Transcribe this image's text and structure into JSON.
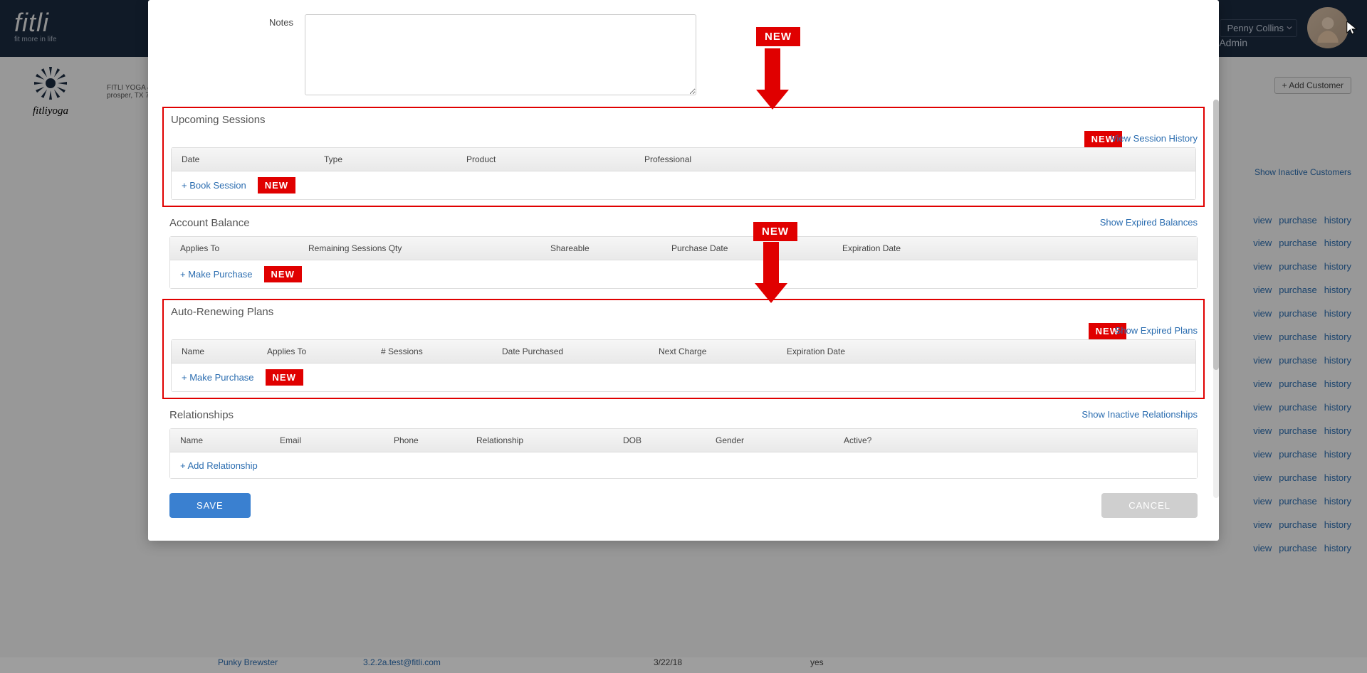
{
  "header": {
    "brand": "fitli",
    "tagline": "fit more in life",
    "user_name": "Penny Collins",
    "admin_link": "Admin"
  },
  "sidebar": {
    "biz_name": "fitliyoga",
    "biz_line1": "FITLI YOGA & ",
    "biz_line2": "prosper, TX 7"
  },
  "bg_page": {
    "add_customer": "+ Add Customer",
    "show_inactive": "Show Inactive Customers",
    "row_links": {
      "view": "view",
      "purchase": "purchase",
      "history": "history"
    },
    "bottom_row": {
      "name": "Punky Brewster",
      "email": "3.2.2a.test@fitli.com",
      "date": "3/22/18",
      "active": "yes"
    }
  },
  "modal": {
    "notes_label": "Notes",
    "upcoming": {
      "title": "Upcoming Sessions",
      "link": "View Session History",
      "cols": {
        "date": "Date",
        "type": "Type",
        "product": "Product",
        "professional": "Professional"
      },
      "action": "+ Book Session"
    },
    "balance": {
      "title": "Account Balance",
      "link": "Show Expired Balances",
      "cols": {
        "applies": "Applies To",
        "remaining": "Remaining Sessions Qty",
        "shareable": "Shareable",
        "purchased": "Purchase Date",
        "expires": "Expiration Date"
      },
      "action": "+ Make Purchase"
    },
    "plans": {
      "title": "Auto-Renewing Plans",
      "link": "Show Expired Plans",
      "cols": {
        "name": "Name",
        "applies": "Applies To",
        "sessions": "# Sessions",
        "purchased": "Date Purchased",
        "next": "Next Charge",
        "expires": "Expiration Date"
      },
      "action": "+ Make Purchase"
    },
    "relationships": {
      "title": "Relationships",
      "link": "Show Inactive Relationships",
      "cols": {
        "name": "Name",
        "email": "Email",
        "phone": "Phone",
        "rel": "Relationship",
        "dob": "DOB",
        "gender": "Gender",
        "active": "Active?"
      },
      "action": "+ Add Relationship"
    },
    "save": "SAVE",
    "cancel": "CANCEL"
  },
  "badges": {
    "new": "NEW"
  },
  "bg_link_rows_tops": [
    302,
    334,
    367,
    400,
    433,
    466,
    499,
    532,
    565,
    598,
    631,
    664,
    697,
    730,
    763
  ]
}
